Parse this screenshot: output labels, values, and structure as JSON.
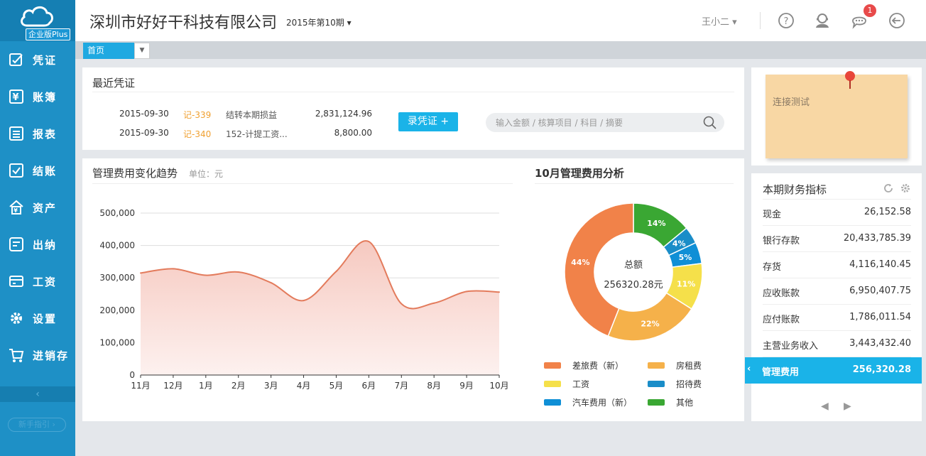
{
  "app": {
    "edition": "企业版Plus"
  },
  "nav": [
    {
      "label": "凭证",
      "icon": "voucher-icon"
    },
    {
      "label": "账簿",
      "icon": "ledger-icon"
    },
    {
      "label": "报表",
      "icon": "report-icon"
    },
    {
      "label": "结账",
      "icon": "checkout-icon"
    },
    {
      "label": "资产",
      "icon": "assets-icon"
    },
    {
      "label": "出纳",
      "icon": "cashier-icon"
    },
    {
      "label": "工资",
      "icon": "salary-icon"
    },
    {
      "label": "设置",
      "icon": "gear-icon"
    },
    {
      "label": "进销存",
      "icon": "inventory-cart-icon"
    }
  ],
  "sidebar": {
    "collapse": "‹",
    "guide": "新手指引 ›"
  },
  "header": {
    "company": "深圳市好好干科技有限公司",
    "period": "2015年第10期 ▾",
    "user": "王小二 ▾",
    "notification_count": "1"
  },
  "tabs": {
    "home": "首页",
    "dropdown": "▼"
  },
  "recent": {
    "title": "最近凭证",
    "rows": [
      {
        "date": "2015-09-30",
        "no": "记-339",
        "desc": "结转本期损益",
        "amount": "2,831,124.96"
      },
      {
        "date": "2015-09-30",
        "no": "记-340",
        "desc": "152-计提工资...",
        "amount": "8,800.00"
      }
    ],
    "button": "录凭证 +",
    "search_placeholder": "输入金额 / 核算项目 / 科目 / 摘要"
  },
  "trend": {
    "title": "管理费用变化趋势",
    "unit": "单位：元"
  },
  "pie": {
    "title": "10月管理费用分析",
    "center_label": "总额",
    "center_value": "256320.28元"
  },
  "chart_data": [
    {
      "type": "area",
      "title": "管理费用变化趋势",
      "categories": [
        "11月",
        "12月",
        "1月",
        "2月",
        "3月",
        "4月",
        "5月",
        "6月",
        "7月",
        "8月",
        "9月",
        "10月"
      ],
      "values": [
        315000,
        328000,
        308000,
        318000,
        285000,
        230000,
        320000,
        412000,
        220000,
        222000,
        258000,
        256000
      ],
      "yticks": [
        "0",
        "100,000",
        "200,000",
        "300,000",
        "400,000",
        "500,000"
      ],
      "ylim": [
        0,
        500000
      ],
      "grid": true,
      "colors": {
        "line": "#e37b5c",
        "fill_top": "#f6c9c0",
        "fill_bottom": "#fdf1ef"
      }
    },
    {
      "type": "pie",
      "title": "10月管理费用分析",
      "slices": [
        {
          "name": "其他",
          "value": 14,
          "label": "14%",
          "color": "#3aa733"
        },
        {
          "name": "招待费",
          "value": 4,
          "label": "4%",
          "color": "#1a8dc8"
        },
        {
          "name": "汽车费用（新）",
          "value": 5,
          "label": "5%",
          "color": "#0f8fd6"
        },
        {
          "name": "工资",
          "value": 11,
          "label": "11%",
          "color": "#f5e04a"
        },
        {
          "name": "房租费",
          "value": 22,
          "label": "22%",
          "color": "#f5b14a"
        },
        {
          "name": "差旅费（新）",
          "value": 44,
          "label": "44%",
          "color": "#f18249"
        }
      ]
    }
  ],
  "legend": [
    {
      "name": "差旅费（新）",
      "color": "#f18249"
    },
    {
      "name": "房租费",
      "color": "#f5b14a"
    },
    {
      "name": "工资",
      "color": "#f5e04a"
    },
    {
      "name": "招待费",
      "color": "#1a8dc8"
    },
    {
      "name": "汽车费用（新）",
      "color": "#0f8fd6"
    },
    {
      "name": "其他",
      "color": "#3aa733"
    }
  ],
  "note": {
    "text": "连接测试"
  },
  "metrics": {
    "title": "本期财务指标",
    "rows": [
      {
        "label": "现金",
        "value": "26,152.58"
      },
      {
        "label": "银行存款",
        "value": "20,433,785.39"
      },
      {
        "label": "存货",
        "value": "4,116,140.45"
      },
      {
        "label": "应收账款",
        "value": "6,950,407.75"
      },
      {
        "label": "应付账款",
        "value": "1,786,011.54"
      },
      {
        "label": "主营业务收入",
        "value": "3,443,432.40"
      },
      {
        "label": "管理费用",
        "value": "256,320.28"
      }
    ],
    "active_index": 6,
    "prev": "◀",
    "next": "▶"
  }
}
